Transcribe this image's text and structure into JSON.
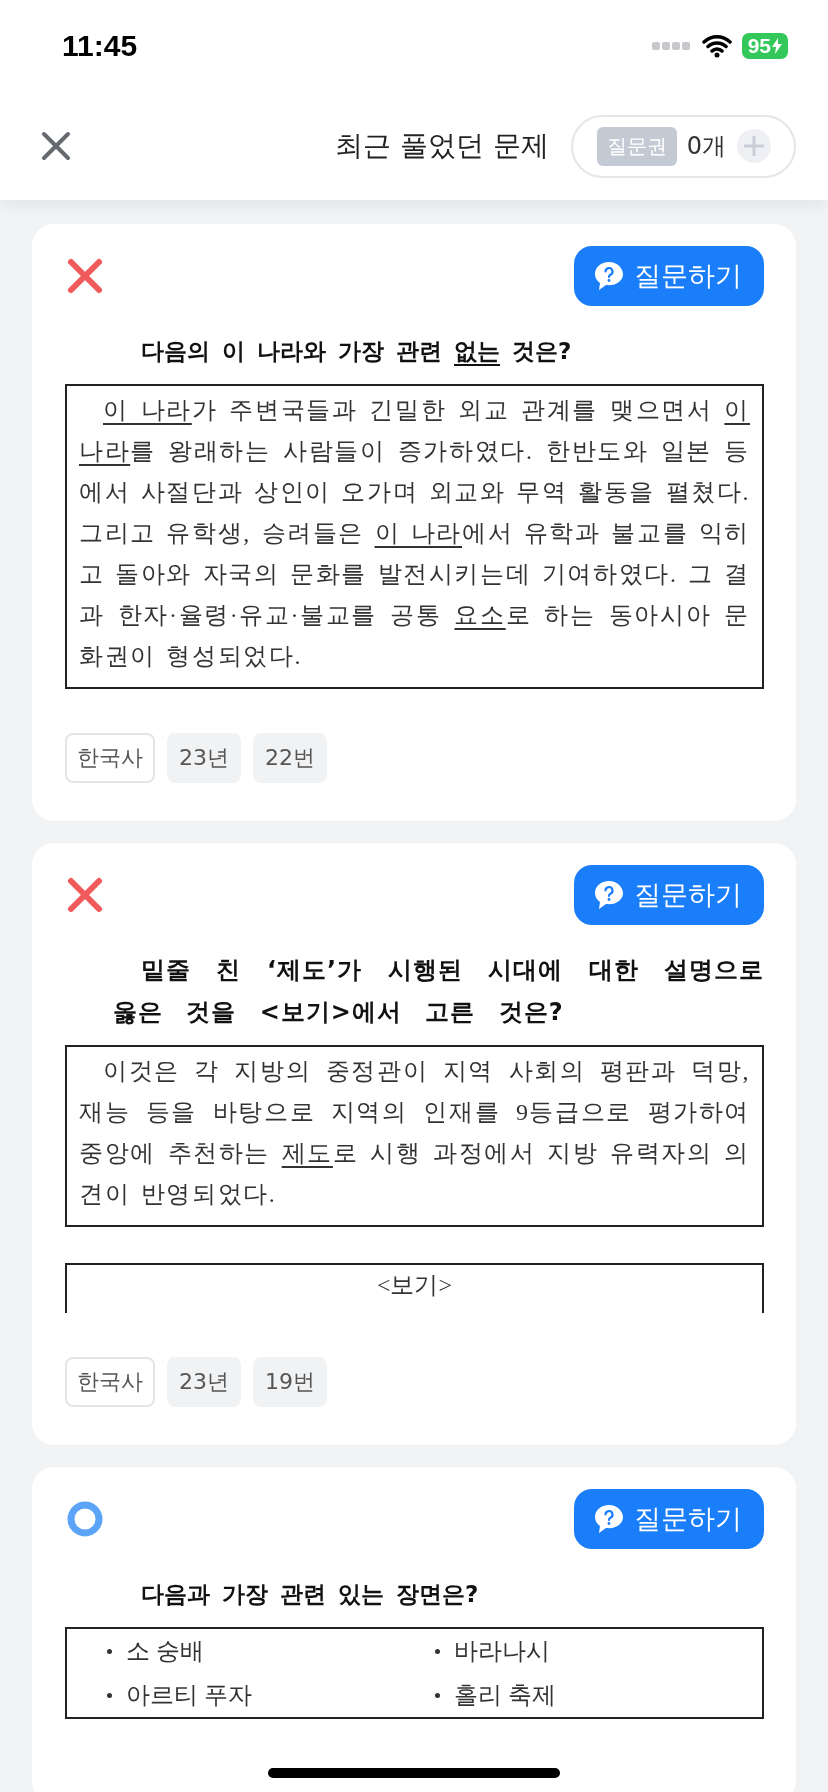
{
  "status_bar": {
    "time": "11:45",
    "battery": "95"
  },
  "header": {
    "title": "최근 풀었던 문제",
    "ticket_label": "질문권",
    "ticket_count": "0개"
  },
  "problems": [
    {
      "correct": false,
      "ask_button": "질문하기",
      "question": [
        {
          "text": "다음의 이 나라와 가장 관련 ",
          "underlined": false
        },
        {
          "text": "없는",
          "underlined": true
        },
        {
          "text": " 것은?",
          "underlined": false
        }
      ],
      "passages": [
        {
          "kind": "passage",
          "runs": [
            {
              "text": "이 나라",
              "underlined": true
            },
            {
              "text": "가 주변국들과 긴밀한 외교 관계를 맺으면서 ",
              "underlined": false
            },
            {
              "text": "이 나라",
              "underlined": true
            },
            {
              "text": "를 왕래하는 사람들이 증가하였다. 한반도와 일본 등에서 사절단과 상인이 오가며 외교와 무역 활동을 펼쳤다. 그리고 유학생, 승려들은 ",
              "underlined": false
            },
            {
              "text": "이 나라",
              "underlined": true
            },
            {
              "text": "에서 유학과 불교를 익히고 돌아와 자국의 문화를 발전시키는데 기여하였다. 그 결과 한자·율령·유교·불교를 공통 ",
              "underlined": false
            },
            {
              "text": "요소",
              "underlined": true
            },
            {
              "text": "로 하는 동아시아 문화권이 형성되었다.",
              "underlined": false
            }
          ]
        }
      ],
      "tags": [
        {
          "kind": "subject",
          "text": "한국사"
        },
        {
          "kind": "meta",
          "text": "23년"
        },
        {
          "kind": "meta",
          "text": "22번"
        }
      ]
    },
    {
      "correct": false,
      "ask_button": "질문하기",
      "question": [
        {
          "text": "밑줄 친 ‘제도’가 시행된 시대에 대한 설명으로 옳은 것을 <보기>에서 고른 것은?",
          "underlined": false
        }
      ],
      "passages": [
        {
          "kind": "passage",
          "runs": [
            {
              "text": "이것은 각 지방의 중정관이 지역 사회의 평판과 덕망, 재능 등을 바탕으로 지역의 인재를 9등급으로 평가하여 중앙에 추천하는 ",
              "underlined": false
            },
            {
              "text": "제도",
              "underlined": true
            },
            {
              "text": "로 시행 과정에서 지방 유력자의 의견이 반영되었다.",
              "underlined": false
            }
          ]
        },
        {
          "kind": "examples",
          "title": "<보기>"
        }
      ],
      "tags": [
        {
          "kind": "subject",
          "text": "한국사"
        },
        {
          "kind": "meta",
          "text": "23년"
        },
        {
          "kind": "meta",
          "text": "19번"
        }
      ]
    },
    {
      "correct": true,
      "ask_button": "질문하기",
      "question": [
        {
          "text": "다음과 가장 관련 있는 장면은?",
          "underlined": false
        }
      ],
      "passages": [
        {
          "kind": "list",
          "items": [
            "소 숭배",
            "바라나시",
            "아르티 푸자",
            "홀리 축제"
          ]
        }
      ]
    }
  ]
}
